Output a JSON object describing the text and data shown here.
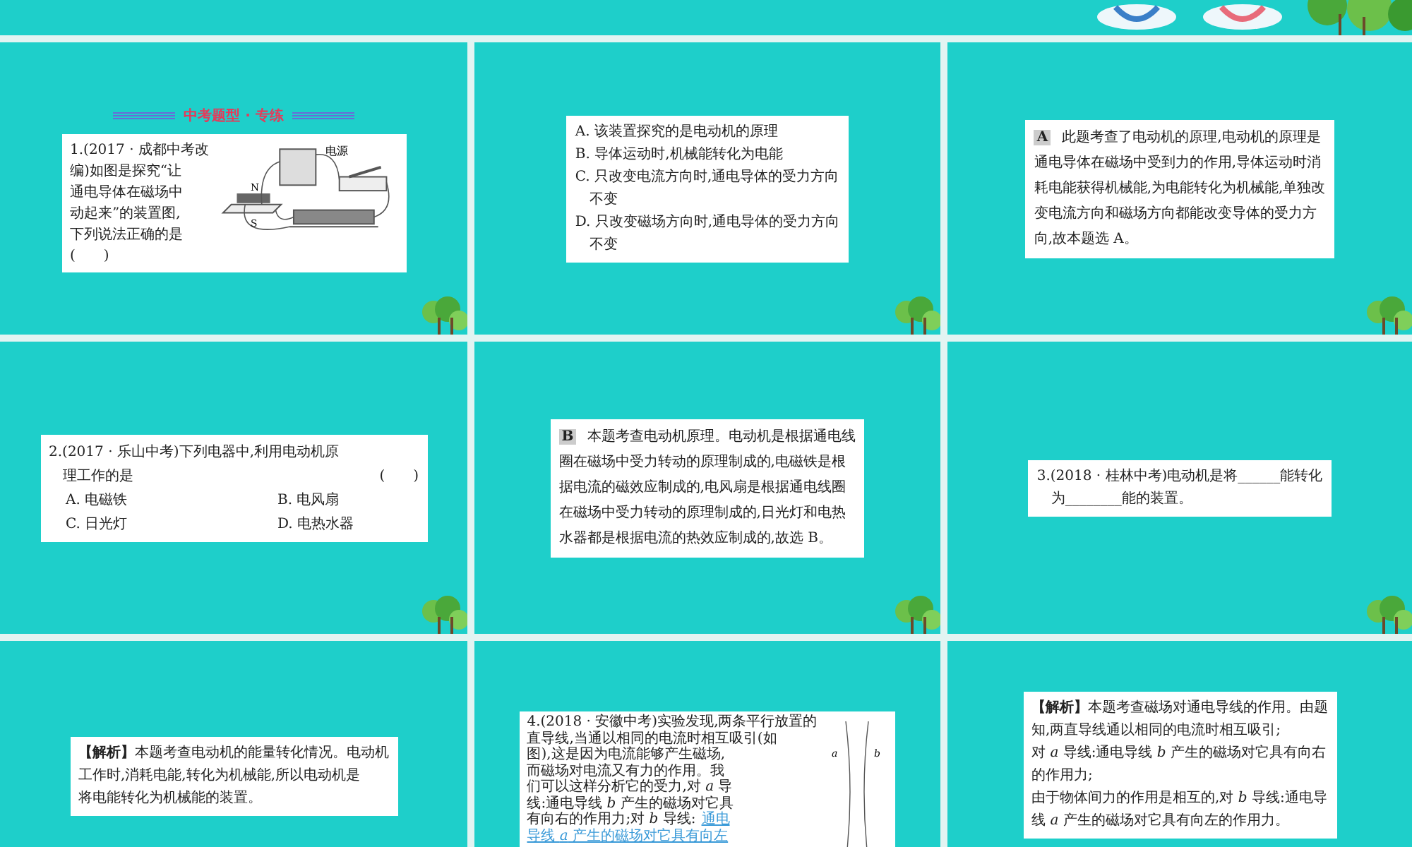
{
  "slides": [
    {
      "kind": "question",
      "heading": "中考题型 · 专练",
      "tree_decoration": true,
      "card": {
        "kind": "figure",
        "lines": [
          "1.(2017 · 成都中考改",
          "编)如图是探究“让",
          "通电导体在磁场中",
          "动起来”的装置图,",
          "下列说法正确的是",
          "(　　)"
        ],
        "figure_labels": [
          "电源",
          "N",
          "S"
        ]
      }
    },
    {
      "kind": "plain",
      "tree_decoration": true,
      "card": {
        "kind": "text",
        "lines": [
          "A. 该装置探究的是电动机的原理",
          "B. 导体运动时,机械能转化为电能",
          "C. 只改变电流方向时,通电导体的受力方向",
          "　不变",
          "D. 只改变磁场方向时,通电导体的受力方向",
          "　不变"
        ]
      }
    },
    {
      "kind": "plain",
      "tree_decoration": true,
      "card": {
        "kind": "answer",
        "tag": "A",
        "lines": [
          "此题考查了电动机的原理,电动机的原理是",
          "通电导体在磁场中受到力的作用,导体运动时消",
          "耗电能获得机械能,为电能转化为机械能,单独改",
          "变电流方向和磁场方向都能改变导体的受力方",
          "向,故本题选 A。"
        ]
      }
    },
    {
      "kind": "plain",
      "tree_decoration": true,
      "card": {
        "kind": "options",
        "lines": [
          "2.(2017 · 乐山中考)下列电器中,利用电动机原",
          "　理工作的是"
        ],
        "bracket": "(　　)",
        "options": [
          "A. 电磁铁",
          "B. 电风扇",
          "C. 日光灯",
          "D. 电热水器"
        ]
      }
    },
    {
      "kind": "plain",
      "tree_decoration": true,
      "card": {
        "kind": "answer",
        "tag": "B",
        "lines": [
          "本题考查电动机原理。电动机是根据通电线",
          "圈在磁场中受力转动的原理制成的,电磁铁是根",
          "据电流的磁效应制成的,电风扇是根据通电线圈",
          "在磁场中受力转动的原理制成的,日光灯和电热",
          "水器都是根据电流的热效应制成的,故选 B。"
        ]
      }
    },
    {
      "kind": "plain",
      "tree_decoration": true,
      "card": {
        "kind": "text",
        "lines": [
          "3.(2018 · 桂林中考)电动机是将______能转化",
          "　为________能的装置。"
        ]
      }
    },
    {
      "kind": "plain",
      "tree_decoration": false,
      "card": {
        "kind": "text",
        "lines": [
          "**【解析】**本题考查电动机的能量转化情况。电动机",
          "工作时,消耗电能,转化为机械能,所以电动机是",
          "将电能转化为机械能的装置。"
        ]
      }
    },
    {
      "kind": "plain",
      "tree_decoration": false,
      "card": {
        "kind": "wires",
        "lines": [
          "4.(2018 · 安徽中考)实验发现,两条平行放置的",
          "直导线,当通以相同的电流时相互吸引(如",
          "图),这是因为电流能够产生磁场,",
          "而磁场对电流又有力的作用。我",
          "们可以这样分析它的受力,对 *a* 导",
          "线:通电导线 *b* 产生的磁场对它具",
          "有向右的作用力;对 *b* 导线:"
        ],
        "answers": [
          "通电",
          "导线 *a* 产生的磁场对它具有向左"
        ],
        "figure_labels": [
          "a",
          "b"
        ]
      }
    },
    {
      "kind": "plain",
      "tree_decoration": false,
      "card": {
        "kind": "text",
        "lines": [
          "**【解析】**本题考查磁场对通电导线的作用。由题",
          "知,两直导线通以相同的电流时相互吸引;",
          "对 *a* 导线:通电导线 *b* 产生的磁场对它具有向右",
          "的作用力;",
          "由于物体间力的作用是相互的,对 *b* 导线:通电导",
          "线 *a* 产生的磁场对它具有向左的作用力。"
        ]
      }
    }
  ]
}
